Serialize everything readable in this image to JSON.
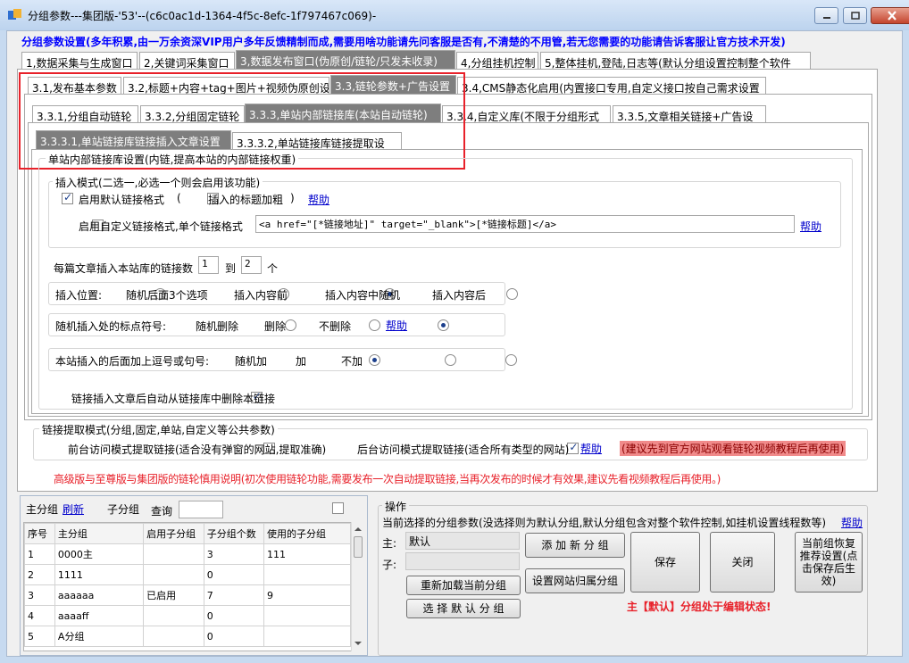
{
  "window": {
    "title": "分组参数---集团版-'53'--(c6c0ac1d-1364-4f5c-8efc-1f797467c069)-"
  },
  "headline": "分组参数设置(多年积累,由一万余资深VIP用户多年反馈精制而成,需要用啥功能请先问客服是否有,不清楚的不用管,若无您需要的功能请告诉客服让官方技术开发)",
  "main_tabs": [
    "1,数据采集与生成窗口",
    "2,关键词采集窗口",
    "3,数据发布窗口(伪原创/链轮/只发未收录)",
    "4,分组挂机控制",
    "5,整体挂机,登陆,日志等(默认分组设置控制整个软件"
  ],
  "sub_tabs": [
    "3.1,发布基本参数",
    "3.2,标题+内容+tag+图片+视频伪原创设",
    "3.3,链轮参数+广告设置",
    "3.4,CMS静态化启用(内置接口专用,自定义接口按自己需求设置"
  ],
  "third_tabs": [
    "3.3.1,分组自动链轮",
    "3.3.2,分组固定链轮",
    "3.3.3,单站内部链接库(本站自动链轮)",
    "3.3.4,自定义库(不限于分组形式",
    "3.3.5,文章相关链接+广告设"
  ],
  "fourth_tabs": [
    "3.3.3.1,单站链接库链接插入文章设置",
    "3.3.3.2,单站链接库链接提取设"
  ],
  "inner": {
    "group_title": "单站内部链接库设置(内链,提高本站的内部链接权重)",
    "insert_mode": {
      "title": "插入模式(二选一,必选一个则会启用该功能)",
      "default_label": "启用默认链接格式",
      "paren_open": "(",
      "bold_label": "插入的标题加粗",
      "paren_close": ")",
      "help1": "帮助",
      "custom_label": "启用自定义链接格式,单个链接格式",
      "custom_value": "<a href=\"[*链接地址]\" target=\"_blank\">[*链接标题]</a>",
      "help2": "帮助"
    },
    "count": {
      "label": "每篇文章插入本站库的链接数",
      "min": "1",
      "to": "到",
      "max": "2",
      "unit": "个"
    },
    "position": {
      "label": "插入位置:",
      "options": [
        "随机后面3个选项",
        "插入内容前",
        "插入内容中随机",
        "插入内容后"
      ]
    },
    "punct": {
      "label": "随机插入处的标点符号:",
      "options": [
        "随机删除",
        "删除",
        "不删除"
      ],
      "help": "帮助"
    },
    "comma": {
      "label": "本站插入的后面加上逗号或句号:",
      "options": [
        "随机加",
        "加",
        "不加"
      ]
    },
    "auto_delete": "链接插入文章后自动从链接库中删除本链接"
  },
  "extract": {
    "title": "链接提取模式(分组,固定,单站,自定义等公共参数)",
    "front_label": "前台访问模式提取链接(适合没有弹窗的网站,提取准确)",
    "back_label": "后台访问模式提取链接(适合所有类型的网站)",
    "help": "帮助",
    "tip": "(建议先到官方网站观看链轮视频教程后再使用)",
    "note": "高级版与至尊版与集团版的链轮慎用说明(初次使用链轮功能,需要发布一次自动提取链接,当再次发布的时候才有效果,建议先看视频教程后再使用。)"
  },
  "groups": {
    "title": "主分组",
    "refresh": "刷新",
    "sub_label": "子分组",
    "query_label": "查询",
    "columns": [
      "序号",
      "主分组",
      "启用子分组",
      "子分组个数",
      "使用的子分组"
    ],
    "rows": [
      [
        "1",
        "0000主",
        "",
        "3",
        "111"
      ],
      [
        "2",
        "1111",
        "",
        "0",
        ""
      ],
      [
        "3",
        "aaaaaa",
        "已启用",
        "7",
        "9"
      ],
      [
        "4",
        "aaaaff",
        "",
        "0",
        ""
      ],
      [
        "5",
        "A分组",
        "",
        "0",
        ""
      ]
    ]
  },
  "ops": {
    "title": "操作",
    "desc": "当前选择的分组参数(没选择则为默认分组,默认分组包含对整个软件控制,如挂机设置线程数等)",
    "help": "帮助",
    "main_label": "主:",
    "main_value": "默认",
    "sub_label": "子:",
    "add_btn": "添 加 新 分 组",
    "reload_btn": "重新加载当前分组",
    "site_btn": "设置网站归属分组",
    "select_btn": "选 择 默 认 分 组",
    "save_btn": "保存",
    "close_btn": "关闭",
    "restore_btn": "当前组恢复推荐设置(点击保存后生效)",
    "status": "主【默认】分组处于编辑状态!"
  },
  "colors": {
    "headline": "#0000ff",
    "active_tab": "#7e7e7e",
    "highlight_box": "#e8212a",
    "tip_bg": "#f08a8a",
    "note": "#e8212a"
  }
}
